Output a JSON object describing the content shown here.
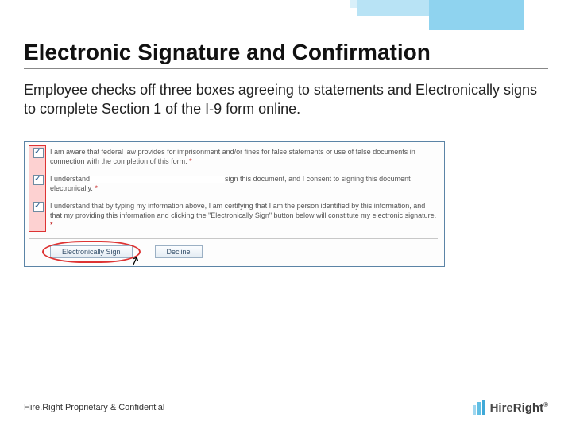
{
  "header": {
    "title": "Electronic Signature and Confirmation",
    "subtitle": "Employee checks off three boxes agreeing to statements and Electronically signs to complete Section 1 of the I-9 form online."
  },
  "form": {
    "checks": [
      {
        "text_before": "I am aware that federal law provides for imprisonment and/or fines for false statements or use of false documents in connection with the completion of this form.",
        "asterisk": "*"
      },
      {
        "text_before": "I understand",
        "has_blank": true,
        "text_after": "sign this document, and I consent to signing this document electronically.",
        "asterisk": "*"
      },
      {
        "text_before": "I understand that by typing my information above, I am certifying that I am the person identified by this information, and that my providing this information and clicking the \"Electronically Sign\" button below will constitute my electronic signature.",
        "asterisk": "*"
      }
    ],
    "buttons": {
      "sign": "Electronically Sign",
      "decline": "Decline"
    }
  },
  "footer": {
    "note": "Hire.Right Proprietary & Confidential",
    "brand_prefix": "Hire",
    "brand_suffix": "Right"
  }
}
